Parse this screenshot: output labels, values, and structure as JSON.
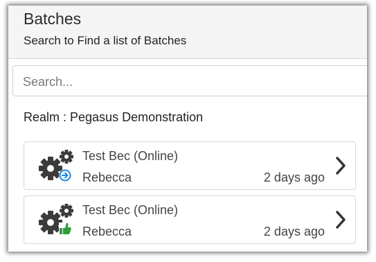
{
  "page": {
    "title": "Batches",
    "subtitle": "Search to Find a list of Batches"
  },
  "search": {
    "placeholder": "Search...",
    "value": ""
  },
  "realm": {
    "label": "Realm : Pegasus Demonstration"
  },
  "batches": [
    {
      "name": "Test Bec (Online)",
      "user": "Rebecca",
      "time": "2 days ago",
      "status_icon": "arrow-right-circle-icon",
      "status_color": "#1e88e5"
    },
    {
      "name": "Test Bec (Online)",
      "user": "Rebecca",
      "time": "2 days ago",
      "status_icon": "thumbs-up-icon",
      "status_color": "#2e9d3a"
    }
  ],
  "colors": {
    "gear": "#3b3b3b",
    "chevron": "#333333",
    "header_bg": "#f5f5f6"
  }
}
